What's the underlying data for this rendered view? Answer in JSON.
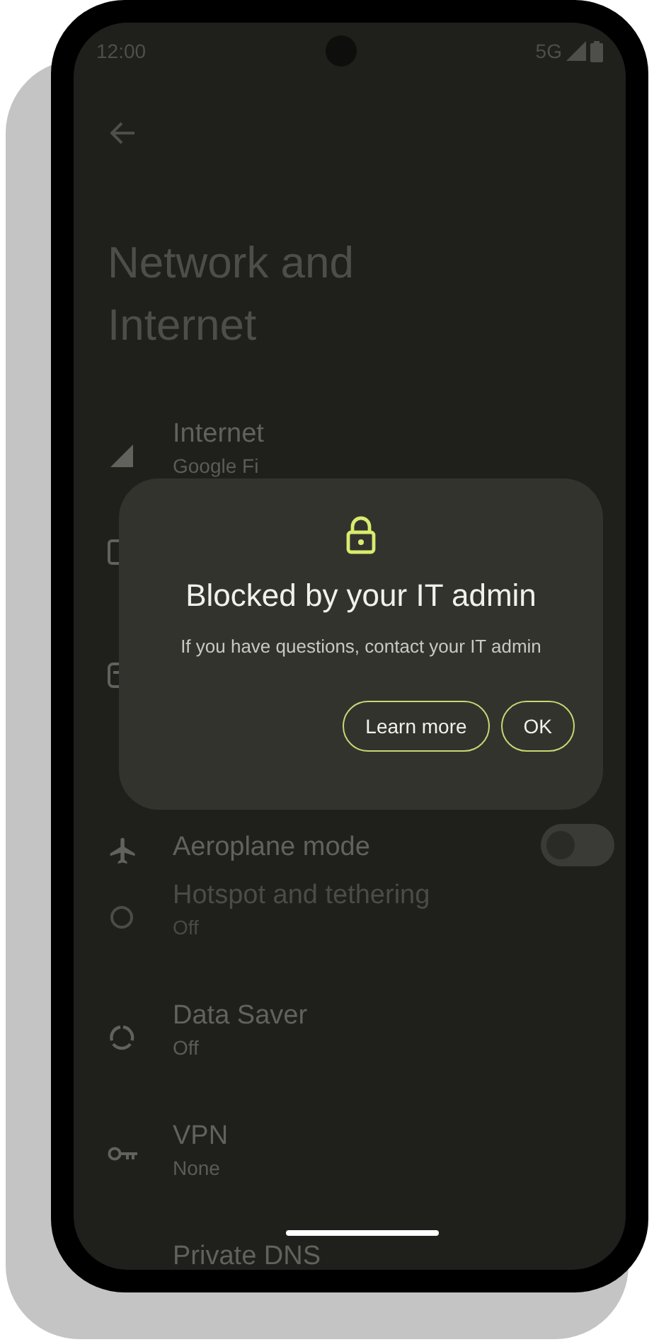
{
  "status_bar": {
    "time": "12:00",
    "network": "5G"
  },
  "title": "Network and Internet",
  "items": [
    {
      "kind": "signal",
      "title": "Internet",
      "subtitle": "Google Fi",
      "disabled": false
    },
    {
      "kind": "sim"
    },
    {
      "kind": "calls"
    },
    {
      "kind": "aeroplane",
      "title": "Aeroplane mode",
      "disabled": false,
      "on": false
    },
    {
      "kind": "hotspot",
      "title": "Hotspot and tethering",
      "subtitle": "Off",
      "disabled": true
    },
    {
      "kind": "datasaver",
      "title": "Data Saver",
      "subtitle": "Off",
      "disabled": false
    },
    {
      "kind": "vpn",
      "title": "VPN",
      "subtitle": "None",
      "disabled": false
    },
    {
      "kind": "dns",
      "title": "Private DNS",
      "disabled": false
    }
  ],
  "dialog": {
    "title": "Blocked by your IT admin",
    "message": "If you have questions, contact your IT admin",
    "buttons": [
      "Learn more",
      "OK"
    ]
  }
}
